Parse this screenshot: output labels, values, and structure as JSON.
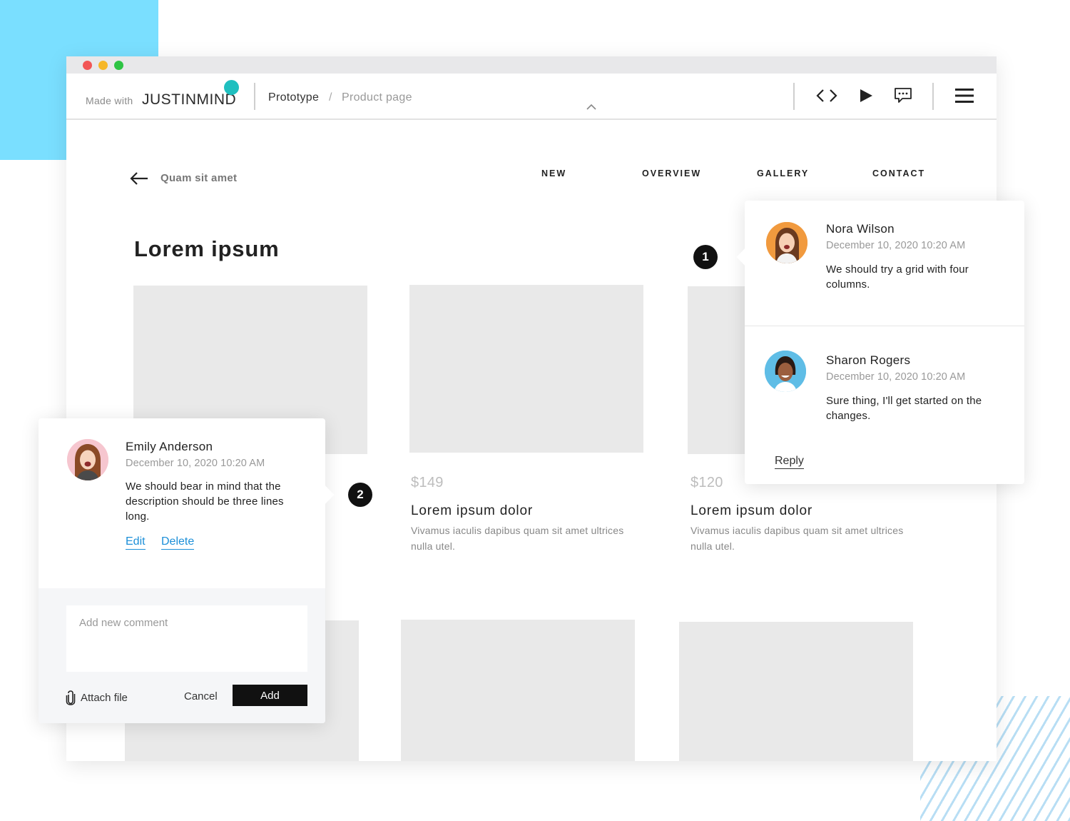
{
  "toolbar": {
    "made_with": "Made with",
    "logo_text": "JUSTINMIND",
    "breadcrumb_root": "Prototype",
    "breadcrumb_sep": "/",
    "breadcrumb_current": "Product page",
    "icons": [
      "code-icon",
      "play-icon",
      "comment-icon",
      "menu-icon"
    ]
  },
  "page": {
    "back_label": "Quam sit amet",
    "nav": [
      "NEW",
      "OVERVIEW",
      "GALLERY",
      "CONTACT"
    ],
    "title": "Lorem ipsum",
    "products": [
      {
        "price": "",
        "title": "",
        "description": ""
      },
      {
        "price": "$149",
        "title": "Lorem ipsum dolor",
        "description": "Vivamus iaculis dapibus quam sit amet ultrices nulla utel."
      },
      {
        "price": "$120",
        "title": "Lorem ipsum dolor",
        "description": "Vivamus iaculis dapibus quam sit amet ultrices nulla utel."
      }
    ]
  },
  "markers": [
    "1",
    "2"
  ],
  "thread_1": {
    "comments": [
      {
        "author": "Nora Wilson",
        "date": "December 10, 2020 10:20 AM",
        "text": "We should try a grid with four columns."
      },
      {
        "author": "Sharon Rogers",
        "date": "December 10, 2020 10:20 AM",
        "text": "Sure thing, I'll get started on the changes."
      }
    ],
    "reply_label": "Reply"
  },
  "thread_2": {
    "author": "Emily Anderson",
    "date": "December 10, 2020 10:20 AM",
    "text": "We should bear in mind that the description should be three lines long.",
    "edit_label": "Edit",
    "delete_label": "Delete",
    "input_placeholder": "Add new comment",
    "attach_label": "Attach file",
    "cancel_label": "Cancel",
    "add_label": "Add"
  },
  "colors": {
    "accent_blue": "#7adfff",
    "logo_dot": "#1fbfbf",
    "link": "#1c8fd8",
    "placeholder_gray": "#e9e9e9"
  }
}
